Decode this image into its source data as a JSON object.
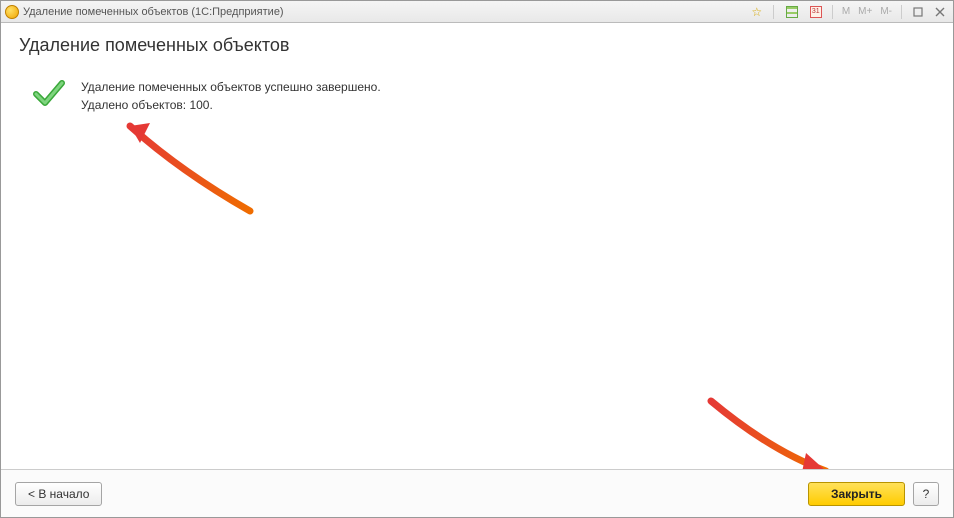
{
  "titlebar": {
    "title": "Удаление помеченных объектов  (1С:Предприятие)",
    "mem_buttons": [
      "M",
      "M+",
      "M-"
    ]
  },
  "heading": "Удаление помеченных объектов",
  "status": {
    "line1": "Удаление помеченных объектов успешно завершено.",
    "line2": "Удалено объектов: 100."
  },
  "footer": {
    "back_label": "< В начало",
    "close_label": "Закрыть",
    "help_label": "?"
  }
}
